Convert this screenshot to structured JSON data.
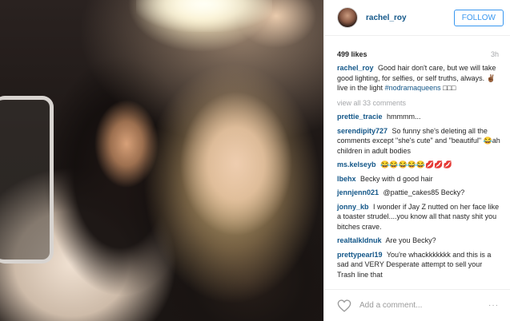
{
  "post": {
    "username": "rachel_roy",
    "follow_label": "FOLLOW",
    "likes": "499 likes",
    "time": "3h",
    "caption": {
      "user": "rachel_roy",
      "text": "Good hair don't care, but we will take good lighting, for selfies, or self truths, always. ✌🏾live in the light",
      "tag": "#nodramaqueens",
      "tail": " □□□"
    },
    "view_all": "view all 33 comments",
    "comments": [
      {
        "user": "prettie_tracie",
        "text": "hmmmm..."
      },
      {
        "user": "serendipity727",
        "text": "So funny she's deleting all the comments except \"she's cute\" and \"beautiful\" 😂ah children in adult bodies"
      },
      {
        "user": "ms.kelseyb",
        "text": "😂😂😂😂😂💋💋💋"
      },
      {
        "user": "lbehx",
        "text": "Becky with d good hair"
      },
      {
        "user": "jennjenn021",
        "text": "@pattie_cakes85 Becky?"
      },
      {
        "user": "jonny_kb",
        "text": "I wonder if Jay Z nutted on her face like a toaster strudel....you know all that nasty shit you bitches crave."
      },
      {
        "user": "realtalkldnuk",
        "text": "Are you Becky?"
      },
      {
        "user": "prettypearl19",
        "text": "You're whackkkkkkk and this is a sad and VERY Desperate attempt to sell your Trash line that"
      }
    ],
    "add_comment_placeholder": "Add a comment...",
    "more_label": "···"
  },
  "colors": {
    "username": "#125688",
    "follow": "#3897f0",
    "muted": "#a5a7aa"
  }
}
